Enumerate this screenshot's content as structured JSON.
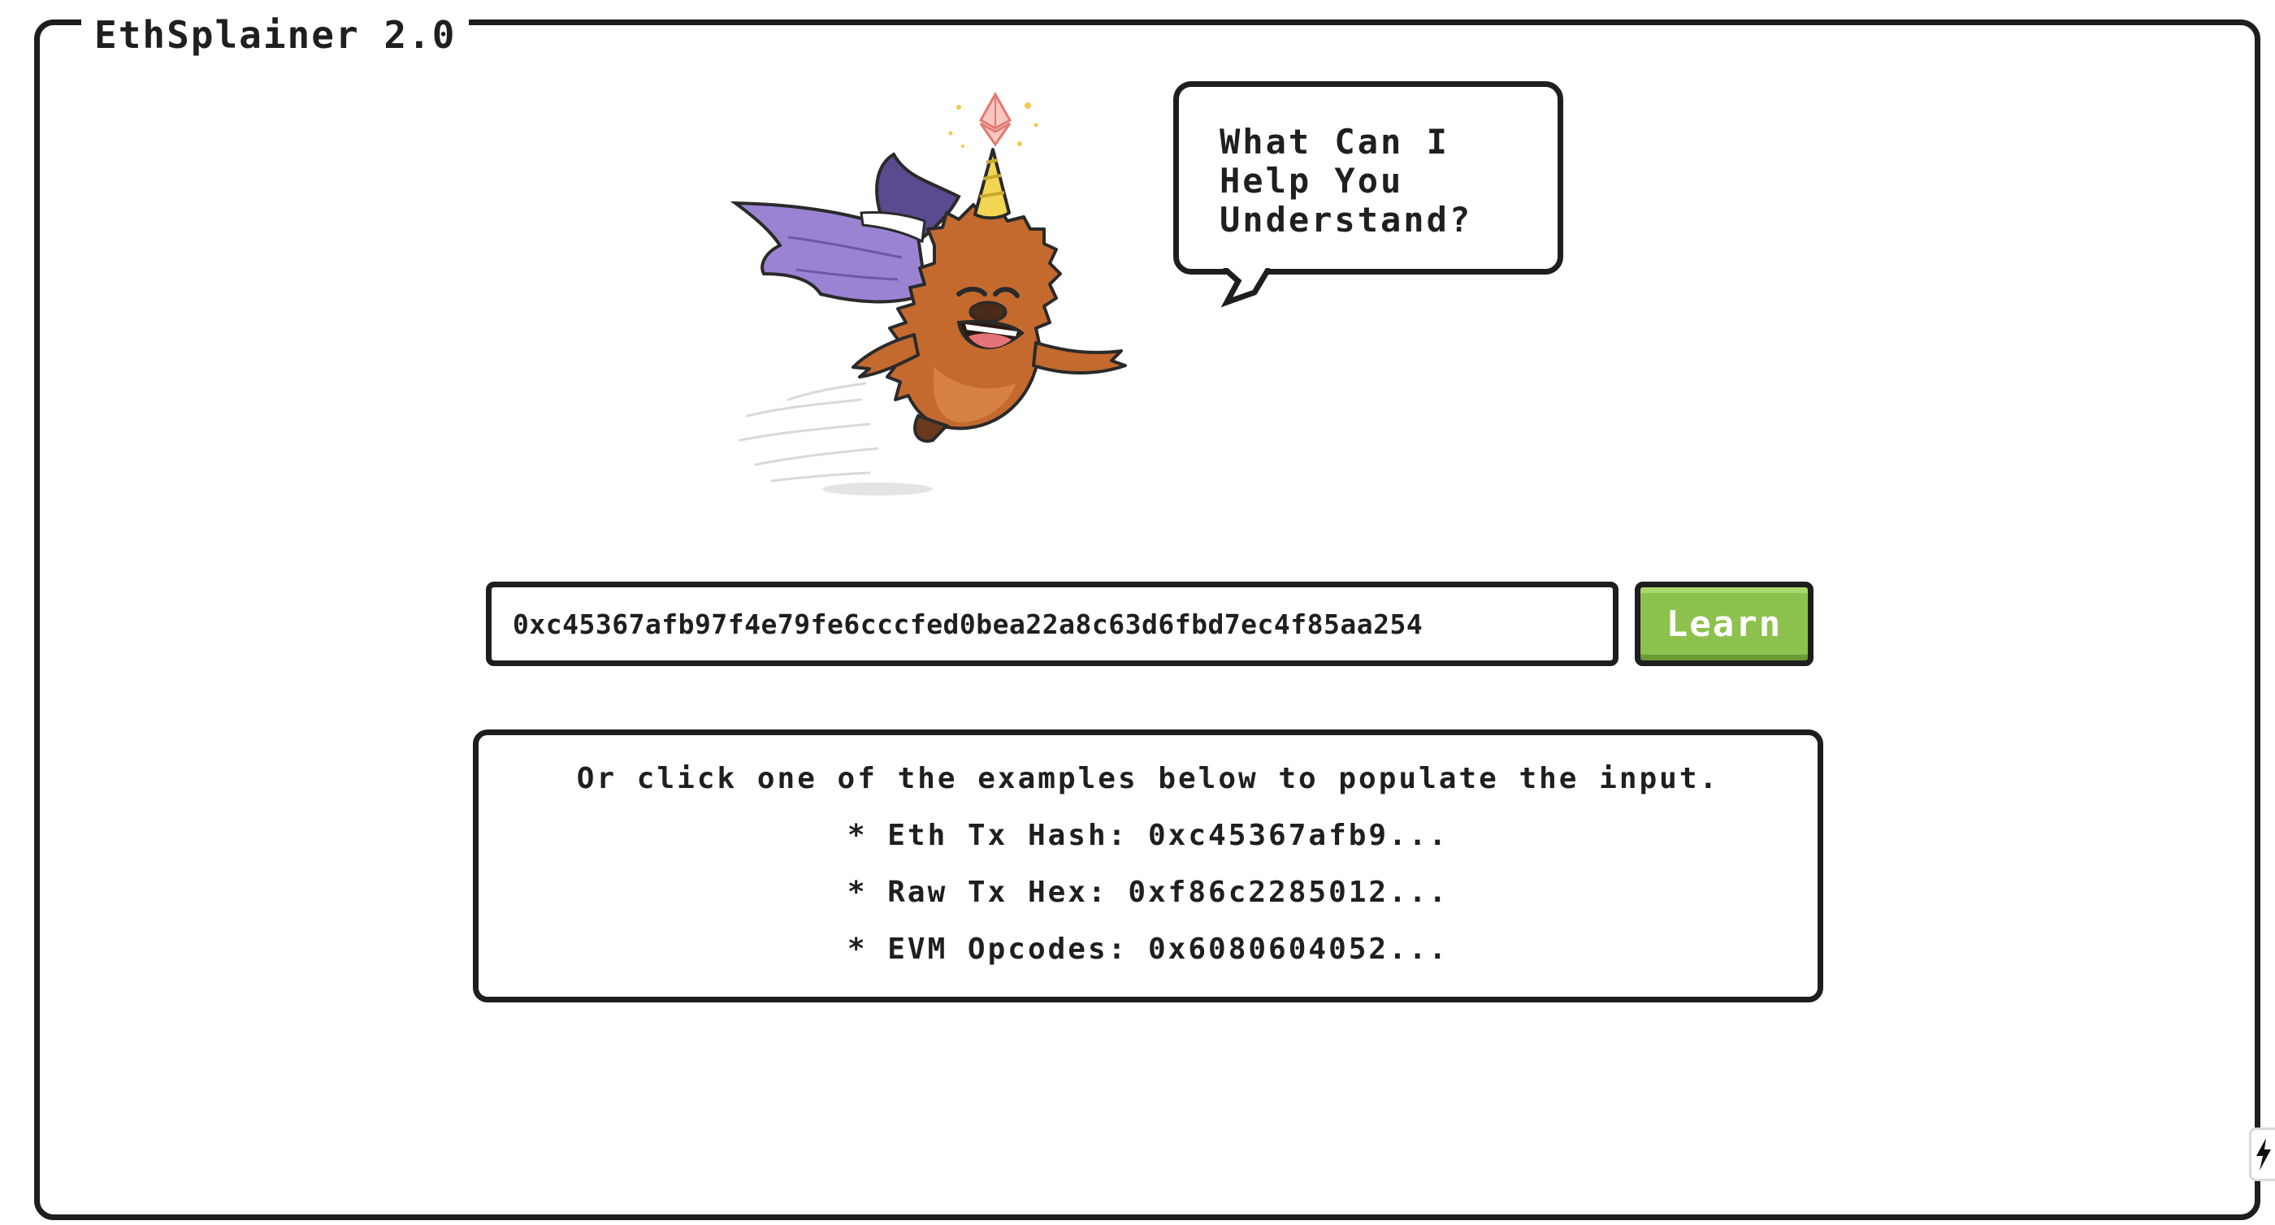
{
  "app": {
    "title": "EthSplainer 2.0"
  },
  "bubble": {
    "text": "What Can I\nHelp You\nUnderstand?"
  },
  "input": {
    "value": "0xc45367afb97f4e79fe6cccfed0bea22a8c63d6fbd7ec4f85aa254"
  },
  "learn_button": {
    "label": "Learn"
  },
  "examples": {
    "intro": "Or click one of the examples below to populate the input.",
    "items": [
      {
        "label": "* Eth Tx Hash: 0xc45367afb9..."
      },
      {
        "label": "* Raw Tx Hex: 0xf86c2285012..."
      },
      {
        "label": "* EVM Opcodes: 0x6080604052..."
      }
    ]
  },
  "colors": {
    "border": "#1e1e1e",
    "button_green": "#8dc14d",
    "mascot_fur": "#c46a2f",
    "wing_purple": "#8d72c8",
    "horn_yellow": "#f2d653"
  },
  "icons": {
    "mascot": "winged-unicorn-bison-mascot",
    "eth": "ethereum-logo-icon",
    "tab": "lightning-bolt-icon"
  }
}
